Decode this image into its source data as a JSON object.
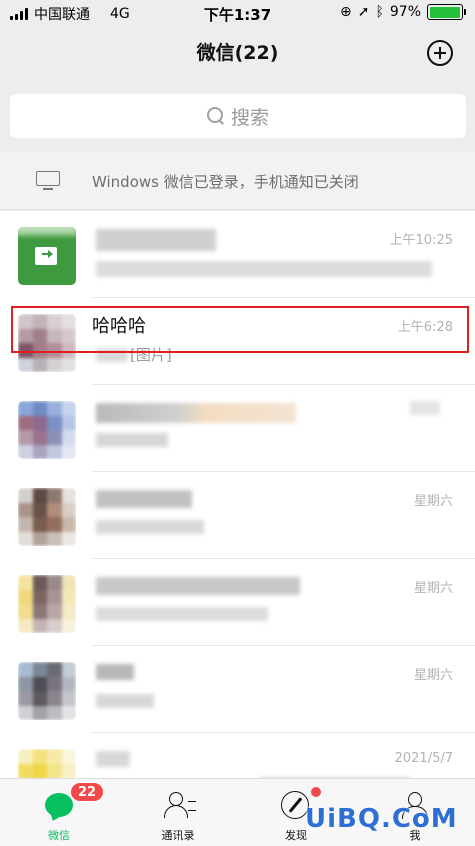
{
  "status_bar": {
    "carrier": "中国联通",
    "network": "4G",
    "time": "下午1:37",
    "battery": "97%",
    "battery_level": 0.97
  },
  "nav": {
    "title": "微信(22)"
  },
  "search": {
    "placeholder": "搜索"
  },
  "notice": {
    "text": "Windows 微信已登录，手机通知已关闭"
  },
  "chats": [
    {
      "name": "",
      "preview": "",
      "time": "上午10:25",
      "avatar_color": "#3e9a3e"
    },
    {
      "name": "哈哈哈",
      "preview": "[图片]",
      "time": "上午6:28",
      "highlighted": true
    },
    {
      "name": "",
      "preview": "",
      "time": ""
    },
    {
      "name": "",
      "preview": "",
      "time": "星期六"
    },
    {
      "name": "",
      "preview": "",
      "time": "星期六"
    },
    {
      "name": "",
      "preview": "",
      "time": "星期六"
    },
    {
      "name": "",
      "preview": "",
      "time": "2021/5/7"
    }
  ],
  "tabs": [
    {
      "label": "微信",
      "badge": "22",
      "active": true,
      "icon": "chat-bubble-icon"
    },
    {
      "label": "通讯录",
      "icon": "contacts-icon"
    },
    {
      "label": "发现",
      "icon": "compass-icon",
      "dot": true
    },
    {
      "label": "我",
      "icon": "person-icon"
    }
  ],
  "watermark": "UiBQ.CoM",
  "colors": {
    "accent": "#07c160",
    "badge": "#f24a4a",
    "highlight_border": "#e02020"
  }
}
